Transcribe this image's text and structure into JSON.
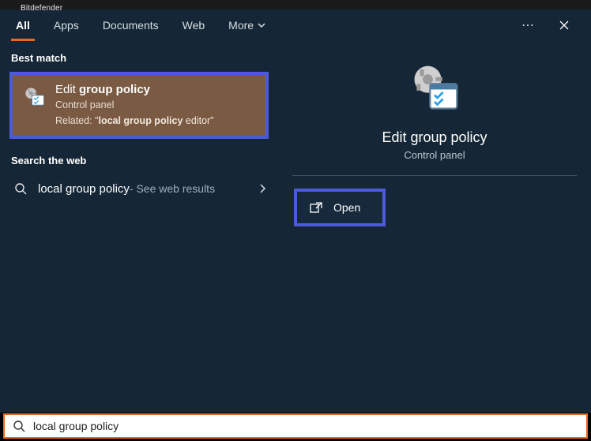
{
  "taskbar": {
    "app_hint": "Bitdefender"
  },
  "tabs": {
    "all": "All",
    "apps": "Apps",
    "documents": "Documents",
    "web": "Web",
    "more": "More"
  },
  "sections": {
    "best_match": "Best match",
    "search_web": "Search the web"
  },
  "result": {
    "title_prefix": "Edit ",
    "title_bold": "group policy",
    "subtitle": "Control panel",
    "related_prefix": "Related: \"",
    "related_bold": "local group policy",
    "related_suffix": " editor\""
  },
  "web_result": {
    "query": "local group policy",
    "hint": " - See web results"
  },
  "preview": {
    "title": "Edit group policy",
    "subtitle": "Control panel",
    "open_label": "Open"
  },
  "search": {
    "value": "local group policy"
  },
  "more_menu_label": "⋯"
}
